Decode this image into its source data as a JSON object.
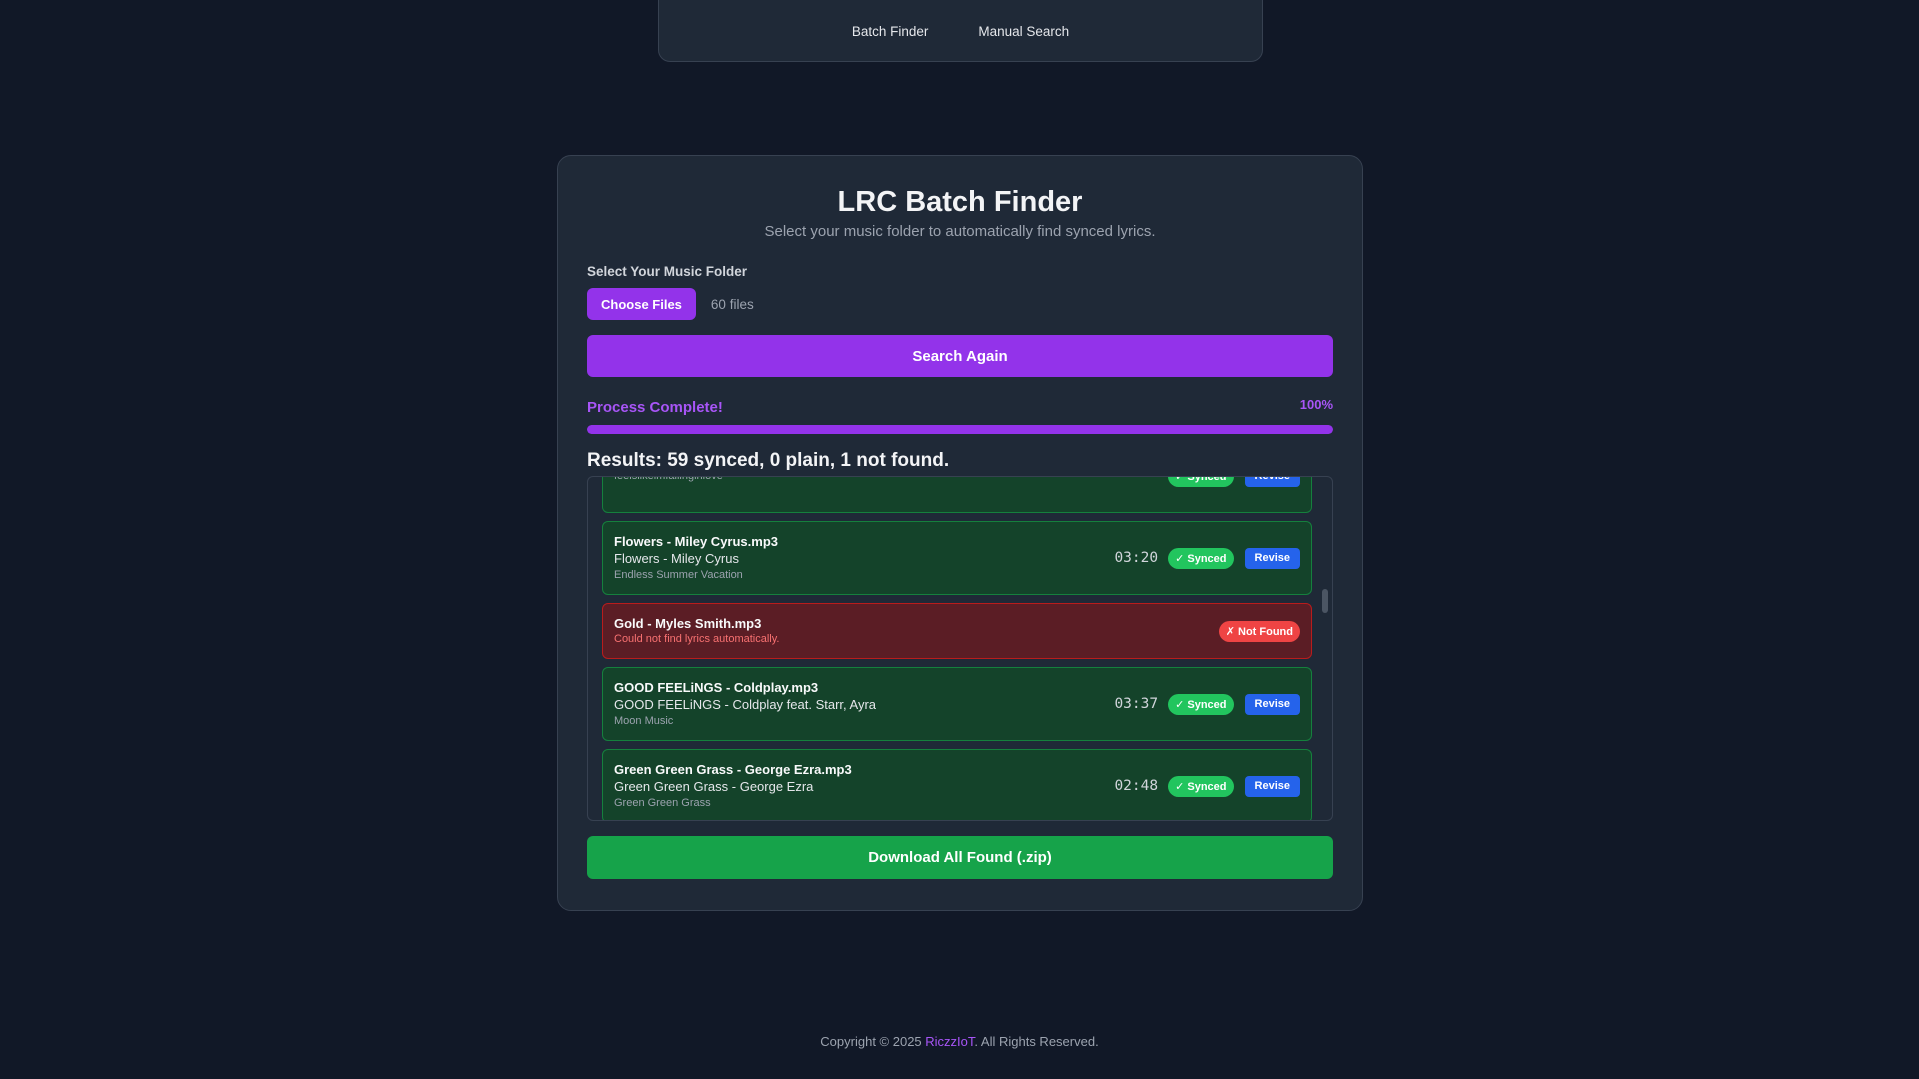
{
  "nav": {
    "items": [
      "Batch Finder",
      "Manual Search"
    ]
  },
  "header": {
    "title": "LRC Batch Finder",
    "subtitle": "Select your music folder to automatically find synced lyrics."
  },
  "folder": {
    "label": "Select Your Music Folder",
    "button": "Choose Files",
    "count": "60 files"
  },
  "search_button": "Search Again",
  "progress": {
    "label": "Process Complete!",
    "percent_text": "100%",
    "value": 1.0
  },
  "results": {
    "summary": "Results: 59 synced, 0 plain, 1 not found.",
    "items": [
      {
        "status": "synced",
        "file": "",
        "track": "",
        "album": "feelslikeimfallinginlove",
        "duration": "",
        "badge": "✓ Synced",
        "action": "Revise"
      },
      {
        "status": "synced",
        "file": "Flowers - Miley Cyrus.mp3",
        "track": "Flowers - Miley Cyrus",
        "album": "Endless Summer Vacation",
        "duration": "03:20",
        "badge": "✓ Synced",
        "action": "Revise"
      },
      {
        "status": "notfound",
        "file": "Gold - Myles Smith.mp3",
        "error": "Could not find lyrics automatically.",
        "badge": "✗ Not Found"
      },
      {
        "status": "synced",
        "file": "GOOD FEELiNGS - Coldplay.mp3",
        "track": "GOOD FEELiNGS - Coldplay feat. Starr, Ayra",
        "album": "Moon Music",
        "duration": "03:37",
        "badge": "✓ Synced",
        "action": "Revise"
      },
      {
        "status": "synced",
        "file": "Green Green Grass - George Ezra.mp3",
        "track": "Green Green Grass - George Ezra",
        "album": "Green Green Grass",
        "duration": "02:48",
        "badge": "✓ Synced",
        "action": "Revise"
      }
    ]
  },
  "download_button": "Download All Found (.zip)",
  "footer": {
    "prefix": "Copyright © 2025 ",
    "brand": "RiczzIoT",
    "suffix": ". All Rights Reserved."
  },
  "colors": {
    "accent": "#9333ea",
    "success": "#16a34a",
    "danger": "#ef4444",
    "info": "#2563eb"
  }
}
